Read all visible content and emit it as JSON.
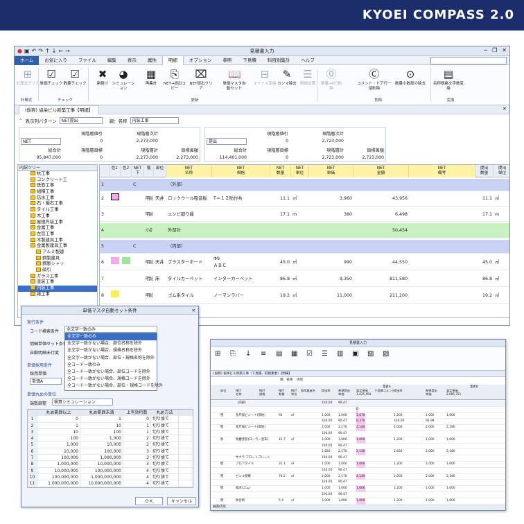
{
  "banner": {
    "brand": "KYOEI COMPASS 2.0",
    "color": "#1b2e6b"
  },
  "window": {
    "title": "見積書入力",
    "menu": [
      "ホーム",
      "お気に入り",
      "ファイル",
      "編集",
      "表示",
      "属性",
      "明細",
      "オプション",
      "参照",
      "下見積",
      "科目別集計",
      "ヘルプ"
    ],
    "active_menu": "明細",
    "ribbon": {
      "buttons": [
        {
          "label": "計算式クリア",
          "icon": "calc-grid-icon",
          "enabled": false
        },
        {
          "label": "単価チェック",
          "icon": "checkbox-icon",
          "enabled": true
        },
        {
          "label": "数量チェック",
          "icon": "checkbox-icon",
          "enabled": true
        },
        {
          "label": "割掛け",
          "icon": "x-icon",
          "enabled": true
        },
        {
          "label": "シミュレーション",
          "icon": "pie-icon",
          "enabled": true
        },
        {
          "label": "再集計",
          "icon": "calculator-icon",
          "enabled": true
        },
        {
          "label": "NET→提出コピー",
          "icon": "doc-arrow-icon",
          "enabled": true
        },
        {
          "label": "NET提出クリア",
          "icon": "doc-x-icon",
          "enabled": true
        },
        {
          "label": "単価マスタ自動セット",
          "icon": "book-icon",
          "enabled": true
        },
        {
          "label": "マイナス変換",
          "icon": "minus-icon",
          "enabled": false
        },
        {
          "label": "カンマ除去",
          "icon": "comment-icon",
          "enabled": true
        },
        {
          "label": "明細合算",
          "icon": "list-icon",
          "enabled": false
        },
        {
          "label": "数量→0行削除",
          "icon": "zero-icon",
          "enabled": false
        },
        {
          "label": "コメント・ドア行一括削除",
          "icon": "cp-icon",
          "enabled": true
        },
        {
          "label": "数量小数部の除去",
          "icon": "decimal-icon",
          "enabled": true
        },
        {
          "label": "名称規格文字数変換",
          "icon": "text-convert-icon",
          "enabled": true
        }
      ],
      "groups": [
        "計算式",
        "チェック",
        "更新",
        "削除",
        "変換"
      ]
    },
    "doc_tab": "(仮称) 協栄ビル新築工事【明細】",
    "display_pattern_label": "表示列パターン",
    "display_pattern_value": "NET提出",
    "parent_name_label": "親：名称",
    "parent_name_value": "内装工事",
    "summary_left": {
      "select": "NET",
      "h_discount": "現階層値引",
      "discount": "0",
      "h_subtotal": "現階層次計",
      "subtotal": "2,273,000",
      "h_total": "総合計",
      "total": "95,847,000",
      "h_target": "現階層目標",
      "target": "0",
      "h_current": "現階層計",
      "current": "2,273,000",
      "h_diff": "目標差額",
      "diff": "2,273,000"
    },
    "summary_right": {
      "select": "提出",
      "h_discount": "現階層値引",
      "discount": "0",
      "h_subtotal": "現階層次計",
      "subtotal": "2,723,000",
      "h_total": "総合計",
      "total": "114,401,000",
      "h_target": "現階層目標",
      "target": "0",
      "h_current": "現階層計",
      "current": "2,723,000",
      "h_diff": "目標差額",
      "diff": "2,723,000"
    },
    "tree": {
      "header": "内訳ツリー",
      "items": [
        "杭工事",
        "コンクリート工",
        "鉄筋工事",
        "組積工事",
        "防水工事",
        "石・擬石工事",
        "タイル工事",
        "木工事",
        "屋根外装工事",
        "金属工事",
        "左官工事",
        "木製建具工事",
        "金属製建具工事",
        "アルミ製建",
        "鋼製建具",
        "鋼製シャッ",
        "硝引",
        "ガラス工事",
        "塗装工事",
        "内装工事",
        "雑工事"
      ],
      "selected": "内装工事"
    },
    "grid": {
      "headers": [
        "色1",
        "色2",
        "NET\n下",
        "階",
        "部位",
        "NET\n名称",
        "NET\n規格",
        "NET\n数量",
        "NET\n単位",
        "NET\n単価",
        "NET\n金額",
        "NET\n備考",
        "提出\n数量",
        "提出\n単位"
      ],
      "rows": [
        {
          "no": "1",
          "kai": "",
          "bui": "",
          "name": "（外部）",
          "spec": "",
          "qty": "",
          "unit": "",
          "price": "",
          "amount": "",
          "sq": "",
          "su": "",
          "style": "blue",
          "c": "C"
        },
        {
          "no": "2",
          "kai": "明細",
          "bui": "天井",
          "name": "ロックウール吸音板",
          "spec": "T＝１２貼付共",
          "qty": "11.1",
          "unit": "㎡",
          "price": "3,960",
          "amount": "43,956",
          "sq": "11.1",
          "su": "㎡",
          "style": "",
          "c": "",
          "sw1": "#f7a8e8"
        },
        {
          "no": "3",
          "kai": "明細",
          "bui": "",
          "name": "エンビ廻り縁",
          "spec": "",
          "qty": "17.1",
          "unit": "m",
          "price": "380",
          "amount": "6,498",
          "sq": "17.1",
          "su": "m",
          "style": "",
          "c": ""
        },
        {
          "no": "4",
          "kai": "小計",
          "bui": "",
          "name": "外部計",
          "spec": "",
          "qty": "",
          "unit": "",
          "price": "",
          "amount": "50,454",
          "sq": "",
          "su": "",
          "style": "green",
          "c": ""
        },
        {
          "no": "5",
          "kai": "",
          "bui": "",
          "name": "（内部）",
          "spec": "",
          "qty": "",
          "unit": "",
          "price": "",
          "amount": "",
          "sq": "",
          "su": "",
          "style": "blue",
          "c": "C"
        },
        {
          "no": "6",
          "kai": "明細",
          "bui": "天井",
          "name": "プラスターボード",
          "spec": "Φ9\nＡＢＣ",
          "qty": "45.0",
          "unit": "㎡",
          "price": "990",
          "amount": "44,550",
          "sq": "45.0",
          "su": "㎡",
          "style": "",
          "c": "",
          "sw1": "#f7a8e8",
          "sw2": "#9be89b"
        },
        {
          "no": "7",
          "kai": "明細",
          "bui": "床",
          "name": "タイルカーペット",
          "spec": "インターカーペット",
          "qty": "86.8",
          "unit": "㎡",
          "price": "9,350",
          "amount": "811,580",
          "sq": "86.8",
          "su": "㎡",
          "style": "",
          "c": ""
        },
        {
          "no": "8",
          "kai": "明細",
          "bui": "",
          "name": "ゴム系タイル",
          "spec": "ノーマンラバー",
          "qty": "19.2",
          "unit": "㎡",
          "price": "11,000",
          "amount": "211,200",
          "sq": "19.2",
          "su": "㎡",
          "style": "",
          "c": "",
          "sw1": "#ffee55"
        }
      ]
    }
  },
  "dialog": {
    "title": "単価マスタ自動セット条件",
    "section1": "実行条件",
    "label_code": "コード検索条件",
    "code_value": "全文字一致のみ",
    "label_unitset": "明細単価セット条件",
    "label_check": "自動明細未行度",
    "options": [
      "全文字一致のみ",
      "全文字一致がない場合、部位名称を除外",
      "全文字一致がない場合、規格名称を除外",
      "全文字一致がない場合、部位・規格名称を除外",
      "全コード一致のみ",
      "全コード一致がない場合、部位コードを除外",
      "全コード一致がない場合、規格コードを除外",
      "全コード一致がない場合、部位・規格コードを除外"
    ],
    "section2": "単価採用条件",
    "label_adopt": "採用単価",
    "adopt_value": "単価A",
    "section3": "単価丸めの単位",
    "label_round": "端数調整",
    "round_value": "積算シミュレーション",
    "table_headers": [
      "丸め範囲以上",
      "丸め範囲未満",
      "上有効桁数",
      "丸め方法"
    ],
    "table_rows": [
      [
        "0",
        "1",
        "0",
        "切り捨て"
      ],
      [
        "1",
        "10",
        "1",
        "切り捨て"
      ],
      [
        "10",
        "100",
        "1",
        "切り捨て"
      ],
      [
        "100",
        "1,000",
        "2",
        "切り捨て"
      ],
      [
        "1,000",
        "10,000",
        "2",
        "切り捨て"
      ],
      [
        "10,000",
        "100,000",
        "3",
        "切り捨て"
      ],
      [
        "100,000",
        "1,000,000",
        "3",
        "切り捨て"
      ],
      [
        "1,000,000",
        "10,000,000",
        "3",
        "切り捨て"
      ],
      [
        "10,000,000",
        "100,000,000",
        "4",
        "切り捨て"
      ],
      [
        "100,000,000",
        "1,000,000,000",
        "4",
        "切り捨て"
      ],
      [
        "1,000,000,000",
        "10,000,000,000",
        "4",
        "切り捨て"
      ]
    ],
    "ok": "ＯＫ",
    "cancel": "キャンセル"
  },
  "window2": {
    "title": "見積書入力",
    "doc_tab": "(仮称) 協栄ビル新築工事（下見積、取極業者）【明細】",
    "parent": "親：名称",
    "parent_value": "内装",
    "group_a": "業者A",
    "group_b": "業者B",
    "headers": [
      "部位",
      "NET\n名称",
      "NET\n規格",
      "NET\n数量",
      "NET\n単位",
      "採用業者名",
      "提出率",
      "希望提出\n単価",
      "査定単価\n3,425,494",
      "下見積コメント",
      "提出率",
      "希望提出\n単価",
      "査定単価\n2,085,751"
    ],
    "rows": [
      [
        "",
        "（内部）",
        "",
        "",
        "",
        "",
        "100.00",
        "90.47",
        "",
        "",
        "",
        "",
        ""
      ],
      [
        "",
        "",
        "",
        "",
        "",
        "",
        "",
        "",
        "0",
        "",
        "",
        "",
        ""
      ],
      [
        "壁",
        "長尺塩ビシート(無地)",
        "",
        "91",
        "㎡",
        "",
        "1,000",
        "1,000",
        "1,070",
        "",
        "1,200",
        "1,000",
        "1,000"
      ],
      [
        "",
        "",
        "",
        "",
        "",
        "",
        "100.00",
        "90.47",
        "8,370",
        "",
        "100.00",
        "93.98",
        ""
      ],
      [
        "壁",
        "長尺塩ビシート(無地)",
        "",
        "",
        "",
        "",
        "2,000",
        "2,170",
        "2,140",
        "",
        "2,000",
        "2,000",
        "2,180"
      ],
      [
        "",
        "",
        "",
        "",
        "",
        "",
        "100.00",
        "90.47",
        "",
        "",
        "",
        "",
        ""
      ],
      [
        "防",
        "防塵塗装(ローラー塗布)",
        "",
        "15.7",
        "㎡",
        "",
        "1,000",
        "1,000",
        "1,000",
        "",
        "1,200",
        "1,000",
        "1,000"
      ],
      [
        "",
        "",
        "",
        "",
        "",
        "",
        "100.00",
        "90.47",
        "",
        "",
        "",
        "",
        ""
      ],
      [
        "",
        "",
        "",
        "",
        "",
        "",
        "2,820",
        "2,170",
        "2,140",
        "",
        "2,830",
        "2,000",
        "2,180"
      ],
      [
        "",
        "サクラ フロートプレート",
        "",
        "",
        "",
        "",
        "100.00",
        "90.47",
        "",
        "",
        "",
        "",
        ""
      ],
      [
        "壁",
        "フロアタイル",
        "",
        "31.1",
        "㎡",
        "",
        "1,000",
        "1,000",
        "1,000",
        "",
        "1,200",
        "1,000",
        "1,000"
      ],
      [
        "",
        "",
        "",
        "",
        "",
        "",
        "100.00",
        "90.47",
        "",
        "",
        "",
        "",
        ""
      ],
      [
        "壁",
        "ビニル壁紙",
        "",
        "78.2",
        "㎡",
        "",
        "2,000",
        "2,170",
        "2,140",
        "",
        "2,000",
        "2,000",
        "2,180"
      ],
      [
        "",
        "",
        "",
        "",
        "",
        "",
        "100.00",
        "90.47",
        "",
        "",
        "",
        "",
        ""
      ],
      [
        "壁",
        "幅木(ゴム)",
        "",
        "",
        "",
        "",
        "1,000",
        "1,000",
        "1,000",
        "",
        "1,200",
        "1,000",
        "1,000"
      ],
      [
        "",
        "",
        "",
        "",
        "",
        "",
        "100.00",
        "90.47",
        "",
        "",
        "",
        "",
        ""
      ],
      [
        "壁",
        "防音剤",
        "",
        "5.4",
        "㎡",
        "",
        "1,000",
        "1,000",
        "1,000",
        "",
        "1,200",
        "1,000",
        "1,000"
      ]
    ],
    "status": "展開/内装"
  }
}
